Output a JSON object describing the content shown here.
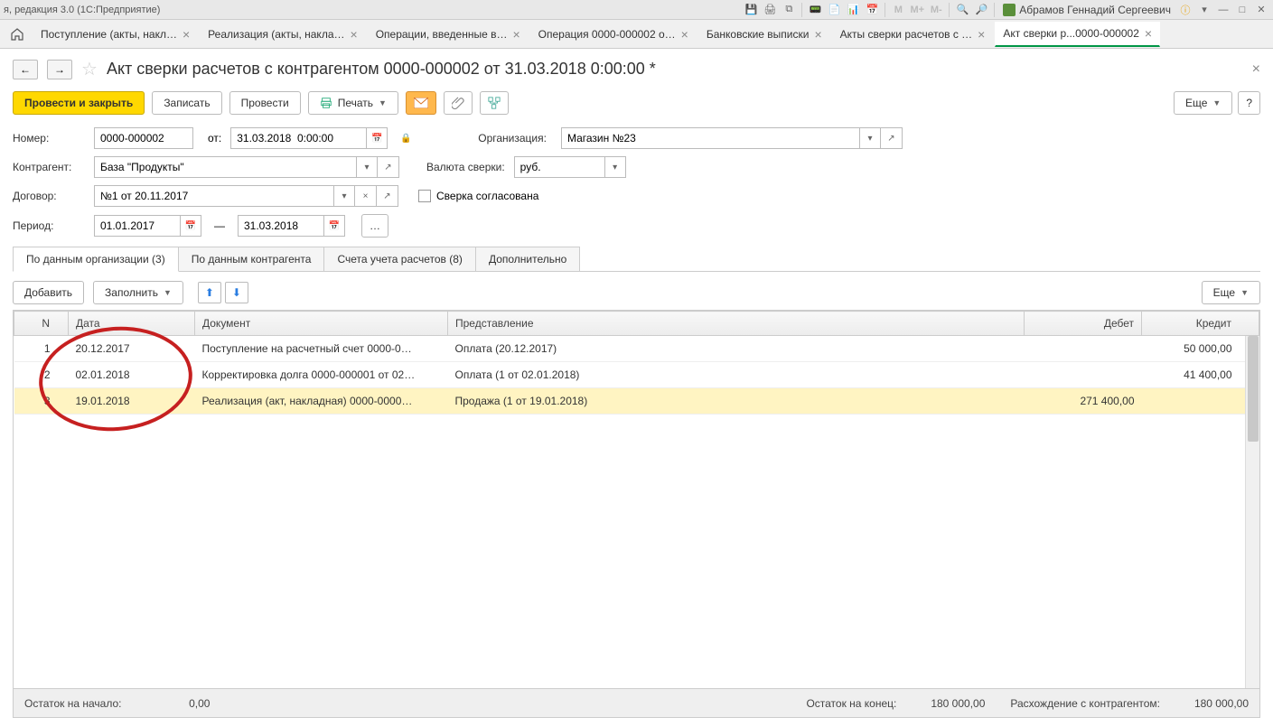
{
  "titlebar": {
    "app": "я, редакция 3.0  (1С:Предприятие)",
    "user": "Абрамов Геннадий Сергеевич"
  },
  "tabs": [
    "Поступление (акты, накл…",
    "Реализация (акты, накла…",
    "Операции, введенные в…",
    "Операция 0000-000002 о…",
    "Банковские выписки",
    "Акты сверки расчетов с …",
    "Акт сверки р...0000-000002"
  ],
  "page": {
    "title": "Акт сверки расчетов с контрагентом 0000-000002 от 31.03.2018 0:00:00 *"
  },
  "toolbar": {
    "postClose": "Провести и закрыть",
    "write": "Записать",
    "post": "Провести",
    "print": "Печать",
    "more": "Еще"
  },
  "form": {
    "numberLabel": "Номер:",
    "number": "0000-000002",
    "fromLabel": "от:",
    "date": "31.03.2018  0:00:00",
    "orgLabel": "Организация:",
    "org": "Магазин №23",
    "counterpartyLabel": "Контрагент:",
    "counterparty": "База \"Продукты\"",
    "currencyLabel": "Валюта сверки:",
    "currency": "руб.",
    "contractLabel": "Договор:",
    "contract": "№1 от 20.11.2017",
    "agreedLabel": "Сверка согласована",
    "periodLabel": "Период:",
    "periodFrom": "01.01.2017",
    "periodTo": "31.03.2018"
  },
  "innerTabs": [
    "По данным организации (3)",
    "По данным контрагента",
    "Счета учета расчетов (8)",
    "Дополнительно"
  ],
  "subtoolbar": {
    "add": "Добавить",
    "fill": "Заполнить",
    "more": "Еще"
  },
  "tableHeaders": {
    "n": "N",
    "date": "Дата",
    "doc": "Документ",
    "repr": "Представление",
    "debit": "Дебет",
    "credit": "Кредит"
  },
  "rows": [
    {
      "n": "1",
      "date": "20.12.2017",
      "doc": "Поступление на расчетный счет 0000-0…",
      "repr": "Оплата (20.12.2017)",
      "debit": "",
      "credit": "50 000,00"
    },
    {
      "n": "2",
      "date": "02.01.2018",
      "doc": "Корректировка долга 0000-000001 от 02…",
      "repr": "Оплата (1 от 02.01.2018)",
      "debit": "",
      "credit": "41 400,00"
    },
    {
      "n": "3",
      "date": "19.01.2018",
      "doc": "Реализация (акт, накладная) 0000-0000…",
      "repr": "Продажа (1 от 19.01.2018)",
      "debit": "271 400,00",
      "credit": ""
    }
  ],
  "footer": {
    "startLabel": "Остаток на начало:",
    "startVal": "0,00",
    "endLabel": "Остаток на конец:",
    "endVal": "180 000,00",
    "diffLabel": "Расхождение с контрагентом:",
    "diffVal": "180 000,00"
  }
}
